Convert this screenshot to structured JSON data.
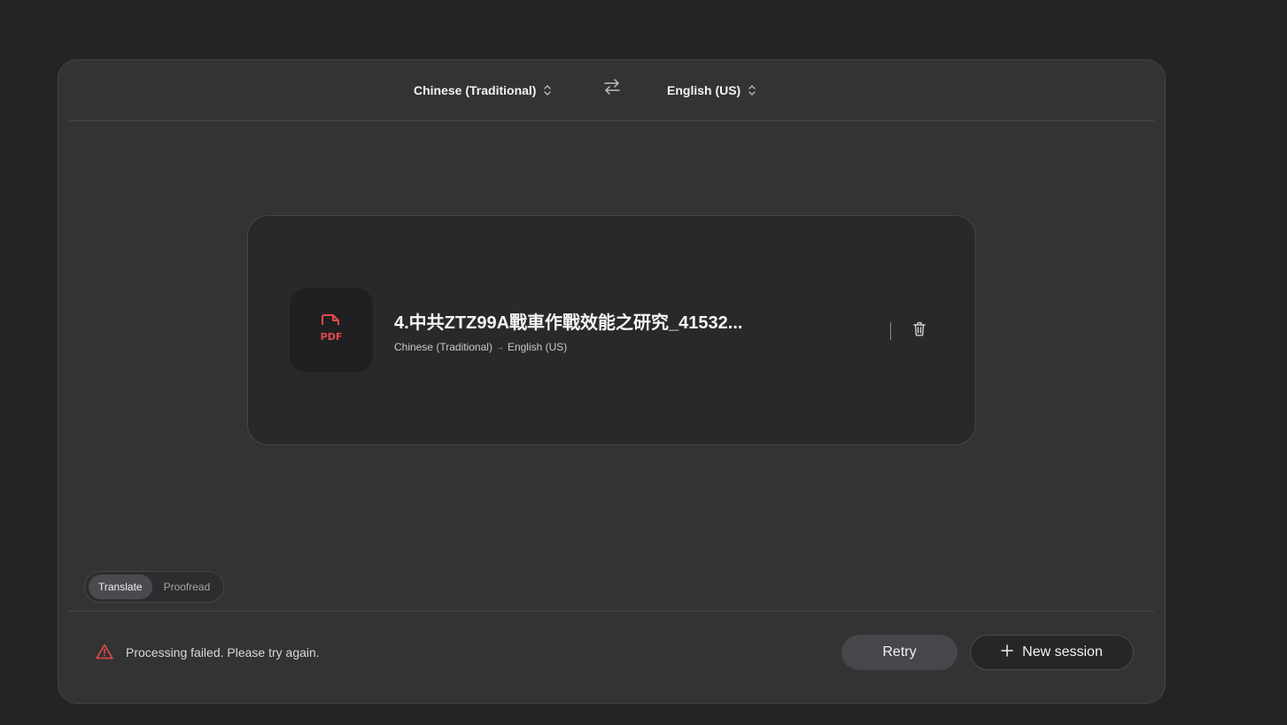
{
  "header": {
    "source_language": "Chinese (Traditional)",
    "target_language": "English (US)",
    "swap_icon": "swap-arrows-icon"
  },
  "file": {
    "type_badge": "PDF",
    "name": "4.中共ZTZ99A戰車作戰效能之研究_41532...",
    "source_language": "Chinese (Traditional)",
    "arrow": "→",
    "target_language": "English (US)"
  },
  "modes": {
    "translate_label": "Translate",
    "proofread_label": "Proofread",
    "selected": "Translate"
  },
  "footer": {
    "status_message": "Processing failed. Please try again.",
    "retry_label": "Retry",
    "new_session_label": "New session"
  },
  "colors": {
    "background": "#242426",
    "panel": "#333334",
    "card": "#29292b",
    "error_accent": "#e5484d"
  }
}
